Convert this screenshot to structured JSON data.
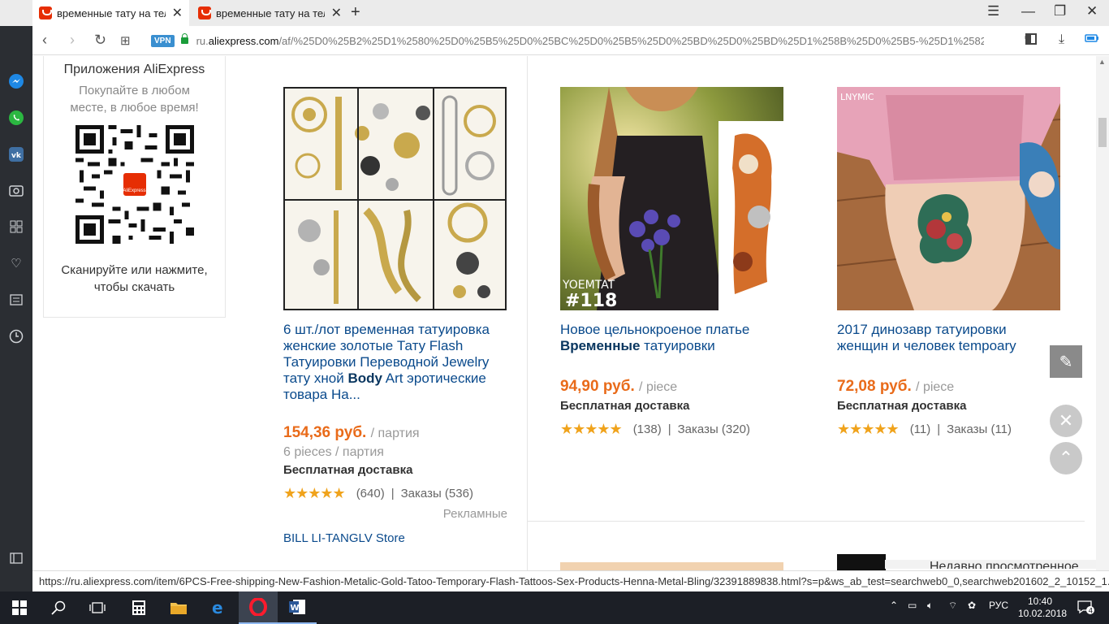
{
  "tabs": [
    {
      "title": "временные тату на тело с",
      "active": true
    },
    {
      "title": "временные тату на тело |",
      "active": false
    }
  ],
  "address": {
    "vpn_label": "VPN",
    "url_prefix": "ru.",
    "url_domain": "aliexpress.com",
    "url_rest": "/af/%25D0%25B2%25D1%2580%25D0%25B5%25D0%25BC%25D0%25B5%25D0%25BD%25D0%25BD%25D1%258B%25D0%25B5-%25D1%2582%25D0%"
  },
  "app_promo": {
    "heading": "Приложения AliExpress",
    "subtext": "Покупайте в любом месте, в любое время!",
    "qr_logo": "AliExpress",
    "scan_text": "Сканируйте или нажмите, чтобы скачать"
  },
  "products": [
    {
      "title_parts": [
        "6 шт./лот временная татуировка женские золотые Тату Flash Татуировки Переводной Jewelry тату хной ",
        "Body",
        " Art эротические товара На..."
      ],
      "price": "154,36 руб.",
      "unit": "/ партия",
      "pieces": "6 pieces / партия",
      "shipping": "Бесплатная доставка",
      "reviews": "(640)",
      "orders": "Заказы (536)",
      "sponsored": "Рекламные",
      "store": "BILL LI-TANGLV Store"
    },
    {
      "title_parts": [
        "Новое цельнокроеное платье ",
        "Временные",
        " татуировки"
      ],
      "price": "94,90 руб.",
      "unit": "/ piece",
      "shipping": "Бесплатная доставка",
      "reviews": "(138)",
      "orders": "Заказы (320)",
      "watermark_brand": "YOEMTAT",
      "watermark_num": "#118"
    },
    {
      "title_parts": [
        "2017 динозавр татуировки женщин и человек tempoary",
        "",
        ""
      ],
      "price": "72,08 руб.",
      "unit": "/ piece",
      "shipping": "Бесплатная доставка",
      "reviews": "(11)",
      "orders": "Заказы (11)"
    }
  ],
  "separator": "|",
  "recently_viewed": "Недавно просмотренное",
  "status_url": "https://ru.aliexpress.com/item/6PCS-Free-shipping-New-Fashion-Metalic-Gold-Tatoo-Temporary-Flash-Tattoos-Sex-Products-Henna-Metal-Bling/32391889838.html?s=p&ws_ab_test=searchweb0_0,searchweb201602_2_10152_1...",
  "taskbar": {
    "lang": "РУС",
    "time": "10:40",
    "date": "10.02.2018",
    "notifications": "4"
  },
  "colors": {
    "accent": "#e62e04",
    "price": "#e96b1a",
    "link": "#0a4a8c",
    "stars": "#f0a31c"
  }
}
